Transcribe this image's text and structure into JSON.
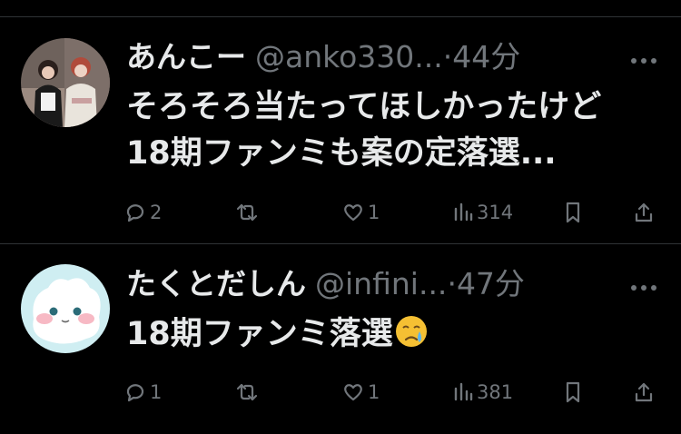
{
  "tweets": [
    {
      "display_name": "あんこー",
      "handle": "@anko330...",
      "dot": "·",
      "time": "44分",
      "text_lines": [
        "そろそろ当たってほしかったけど",
        "18期ファンミも案の定落選..."
      ],
      "emoji": "",
      "replies": "2",
      "retweets": "",
      "likes": "1",
      "views": "314"
    },
    {
      "display_name": "たくとだしん",
      "handle": "@infini...",
      "dot": "·",
      "time": "47分",
      "text_lines": [
        "18期ファンミ落選"
      ],
      "emoji": "crying-face-emoji",
      "replies": "1",
      "retweets": "",
      "likes": "1",
      "views": "381"
    }
  ],
  "icons": {
    "more": "more-horizontal-icon",
    "reply": "reply-icon",
    "retweet": "retweet-icon",
    "like": "heart-icon",
    "views": "views-chart-icon",
    "bookmark": "bookmark-icon",
    "share": "share-icon"
  },
  "colors": {
    "background": "#000000",
    "text": "#e7e9ea",
    "secondary": "#71767b",
    "divider": "#2f3336"
  }
}
